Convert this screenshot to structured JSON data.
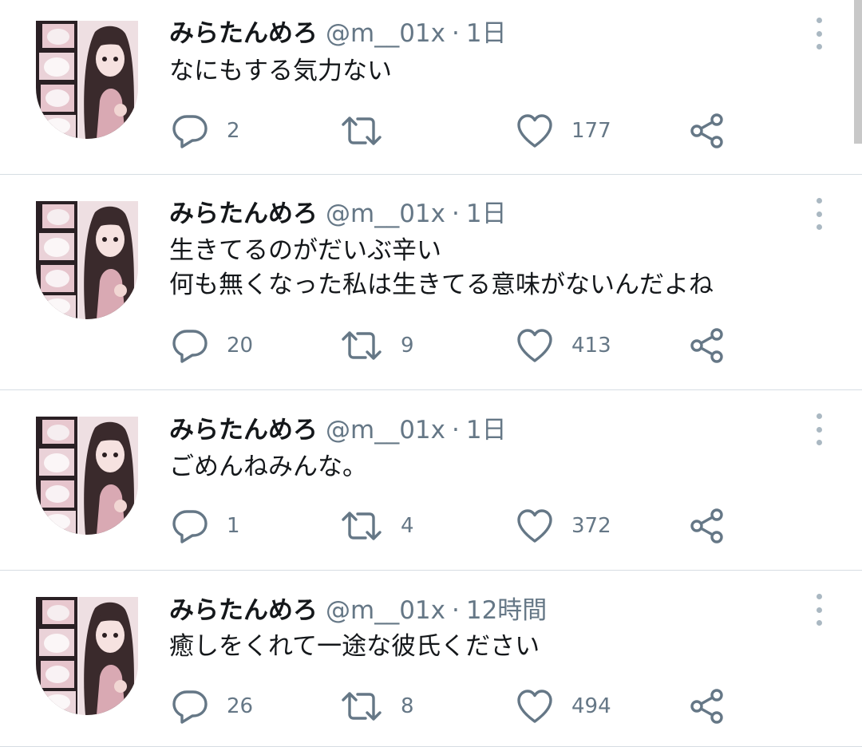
{
  "colors": {
    "text": "#14171a",
    "secondary": "#657786",
    "divider": "#d6dde3",
    "more_dots": "#aab8c2"
  },
  "icons": {
    "reply": "speech-bubble-icon",
    "retweet": "retweet-arrows-icon",
    "like": "heart-outline-icon",
    "share": "share-nodes-icon",
    "more": "vertical-dots-icon"
  },
  "tweets": [
    {
      "display_name": "みらたんめろ",
      "handle": "@m__01x",
      "separator": "·",
      "time": "1日",
      "text": "なにもする気力ない",
      "reply_count": "2",
      "retweet_count": "",
      "like_count": "177"
    },
    {
      "display_name": "みらたんめろ",
      "handle": "@m__01x",
      "separator": "·",
      "time": "1日",
      "text": "生きてるのがだいぶ辛い\n何も無くなった私は生きてる意味がないんだよね",
      "reply_count": "20",
      "retweet_count": "9",
      "like_count": "413"
    },
    {
      "display_name": "みらたんめろ",
      "handle": "@m__01x",
      "separator": "·",
      "time": "1日",
      "text": "ごめんねみんな。",
      "reply_count": "1",
      "retweet_count": "4",
      "like_count": "372"
    },
    {
      "display_name": "みらたんめろ",
      "handle": "@m__01x",
      "separator": "·",
      "time": "12時間",
      "text": "癒しをくれて一途な彼氏ください",
      "reply_count": "26",
      "retweet_count": "8",
      "like_count": "494"
    }
  ]
}
